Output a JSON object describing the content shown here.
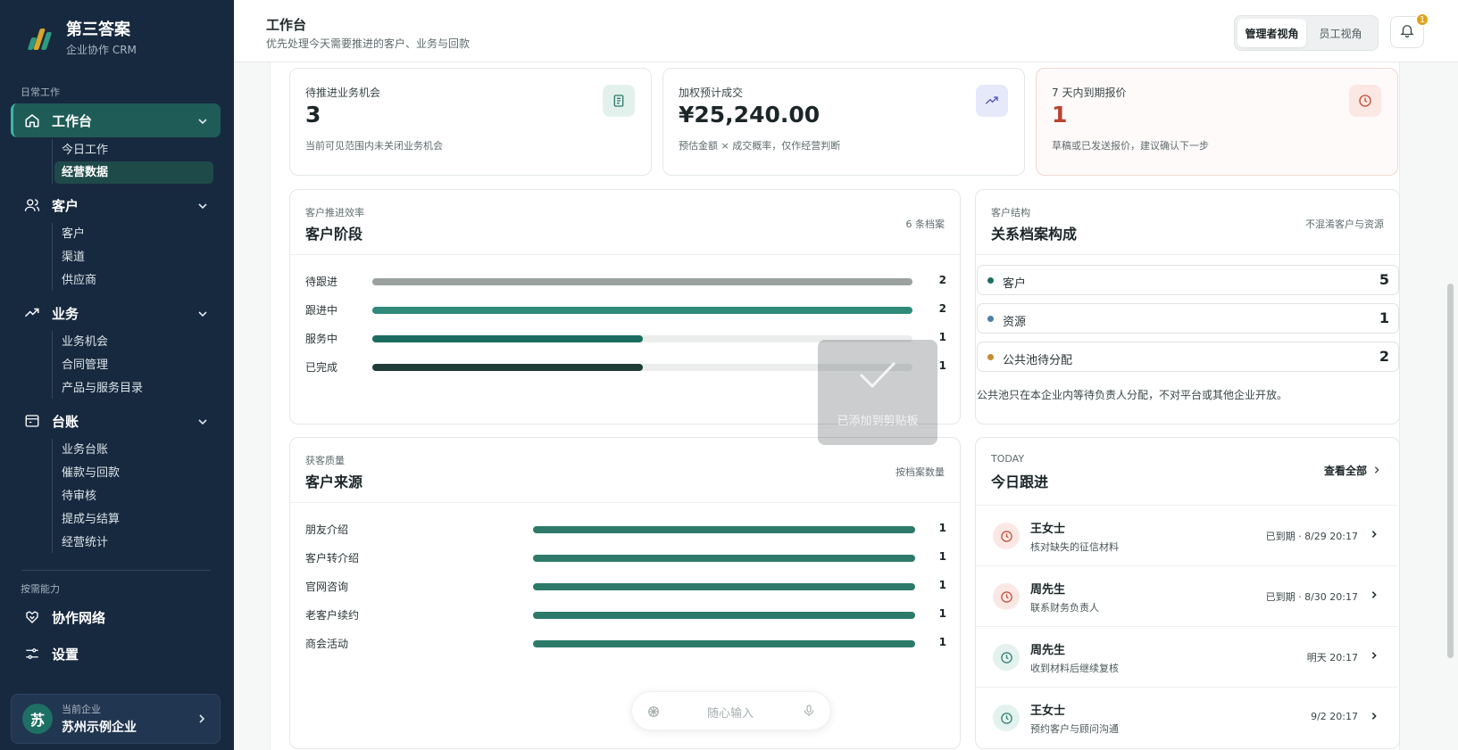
{
  "brand": {
    "title": "第三答案",
    "subtitle": "企业协作 CRM"
  },
  "sidebar": {
    "section_daily": "日常工作",
    "groups": [
      {
        "label": "工作台",
        "icon": "home-icon",
        "items": [
          "今日工作",
          "经营数据"
        ]
      },
      {
        "label": "客户",
        "icon": "users-icon",
        "items": [
          "客户",
          "渠道",
          "供应商"
        ]
      },
      {
        "label": "业务",
        "icon": "trend-icon",
        "items": [
          "业务机会",
          "合同管理",
          "产品与服务目录"
        ]
      },
      {
        "label": "台账",
        "icon": "ledger-icon",
        "items": [
          "业务台账",
          "催款与回款",
          "待审核",
          "提成与结算",
          "经营统计"
        ]
      }
    ],
    "section_optional": "按需能力",
    "extra": [
      {
        "label": "协作网络",
        "icon": "handshake-icon"
      },
      {
        "label": "设置",
        "icon": "sliders-icon"
      }
    ],
    "company": {
      "avatar": "苏",
      "label": "当前企业",
      "name": "苏州示例企业"
    }
  },
  "topbar": {
    "title": "工作台",
    "subtitle": "优先处理今天需要推进的客户、业务与回款",
    "view_manager": "管理者视角",
    "view_staff": "员工视角",
    "notifications": "1"
  },
  "stats": [
    {
      "label": "待推进业务机会",
      "value": "3",
      "desc": "当前可见范围内未关闭业务机会",
      "icon": "document-icon"
    },
    {
      "label": "加权预计成交",
      "value": "¥25,240.00",
      "desc": "预估金额 × 成交概率，仅作经营判断",
      "icon": "trend-up-icon"
    },
    {
      "label": "7 天内到期报价",
      "value": "1",
      "desc": "草稿或已发送报价，建议确认下一步",
      "icon": "clock-icon"
    }
  ],
  "stage_card": {
    "kicker": "客户推进效率",
    "title": "客户阶段",
    "right": "6 条档案"
  },
  "composition_card": {
    "kicker": "客户结构",
    "title": "关系档案构成",
    "right": "不混淆客户与资源",
    "items": [
      {
        "label": "客户",
        "value": "5",
        "color": "#1e6f64"
      },
      {
        "label": "资源",
        "value": "1",
        "color": "#4a7fa8"
      },
      {
        "label": "公共池待分配",
        "value": "2",
        "color": "#c98a2e"
      }
    ],
    "note": "公共池只在本企业内等待负责人分配，不对平台或其他企业开放。"
  },
  "source_card": {
    "kicker": "获客质量",
    "title": "客户来源",
    "right": "按档案数量"
  },
  "followup": {
    "kicker": "TODAY",
    "title": "今日跟进",
    "view_all": "查看全部",
    "items": [
      {
        "name": "王女士",
        "desc": "核对缺失的征信材料",
        "time": "已到期 · 8/29 20:17",
        "overdue": true
      },
      {
        "name": "周先生",
        "desc": "联系财务负责人",
        "time": "已到期 · 8/30 20:17",
        "overdue": true
      },
      {
        "name": "周先生",
        "desc": "收到材料后继续复核",
        "time": "明天 20:17",
        "overdue": false
      },
      {
        "name": "王女士",
        "desc": "预约客户与顾问沟通",
        "time": "9/2 20:17",
        "overdue": false
      }
    ]
  },
  "toast": {
    "text": "已添加到剪贴板"
  },
  "chat": {
    "placeholder": "随心输入"
  },
  "chart_data": [
    {
      "type": "bar",
      "title": "客户阶段",
      "categories": [
        "待跟进",
        "跟进中",
        "服务中",
        "已完成"
      ],
      "values": [
        2,
        2,
        1,
        1
      ],
      "colors": [
        "#9aa19f",
        "#2f8a7a",
        "#1c6c60",
        "#1f3c38"
      ],
      "xlim": [
        0,
        2
      ]
    },
    {
      "type": "bar",
      "title": "客户来源",
      "categories": [
        "朋友介绍",
        "客户转介绍",
        "官网咨询",
        "老客户续约",
        "商会活动"
      ],
      "values": [
        1,
        1,
        1,
        1,
        1
      ],
      "colors": [
        "#2d7a6a",
        "#2d7a6a",
        "#2d7a6a",
        "#2d7a6a",
        "#2d7a6a"
      ],
      "xlim": [
        0,
        1
      ]
    }
  ]
}
